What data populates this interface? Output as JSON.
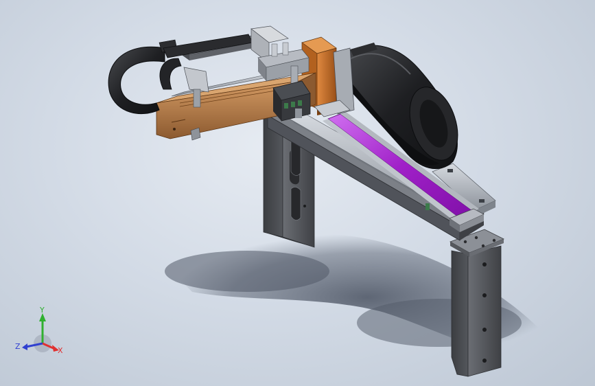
{
  "viewport": {
    "background_top": "#e6ebf2",
    "background_bottom": "#bdc7d4"
  },
  "model": {
    "colors": {
      "frame": "#55575c",
      "frame_dark": "#3b3d41",
      "frame_light": "#8a8d93",
      "rail": "#9aa0a8",
      "rail_light": "#c9ced6",
      "belt": "#1e1f22",
      "belt_highlight": "#45474c",
      "wood": "#b07a4a",
      "wood_dark": "#7a4f2a",
      "orange": "#c8702a",
      "purple": "#a020c8",
      "purple_light": "#d070f0",
      "bracket": "#b8bcc4",
      "green": "#3c7a4a",
      "shadow": "#6a7381"
    }
  },
  "triad": {
    "x_label": "X",
    "y_label": "Y",
    "z_label": "Z",
    "x_color": "#e03030",
    "y_color": "#30b030",
    "z_color": "#3040d0"
  }
}
